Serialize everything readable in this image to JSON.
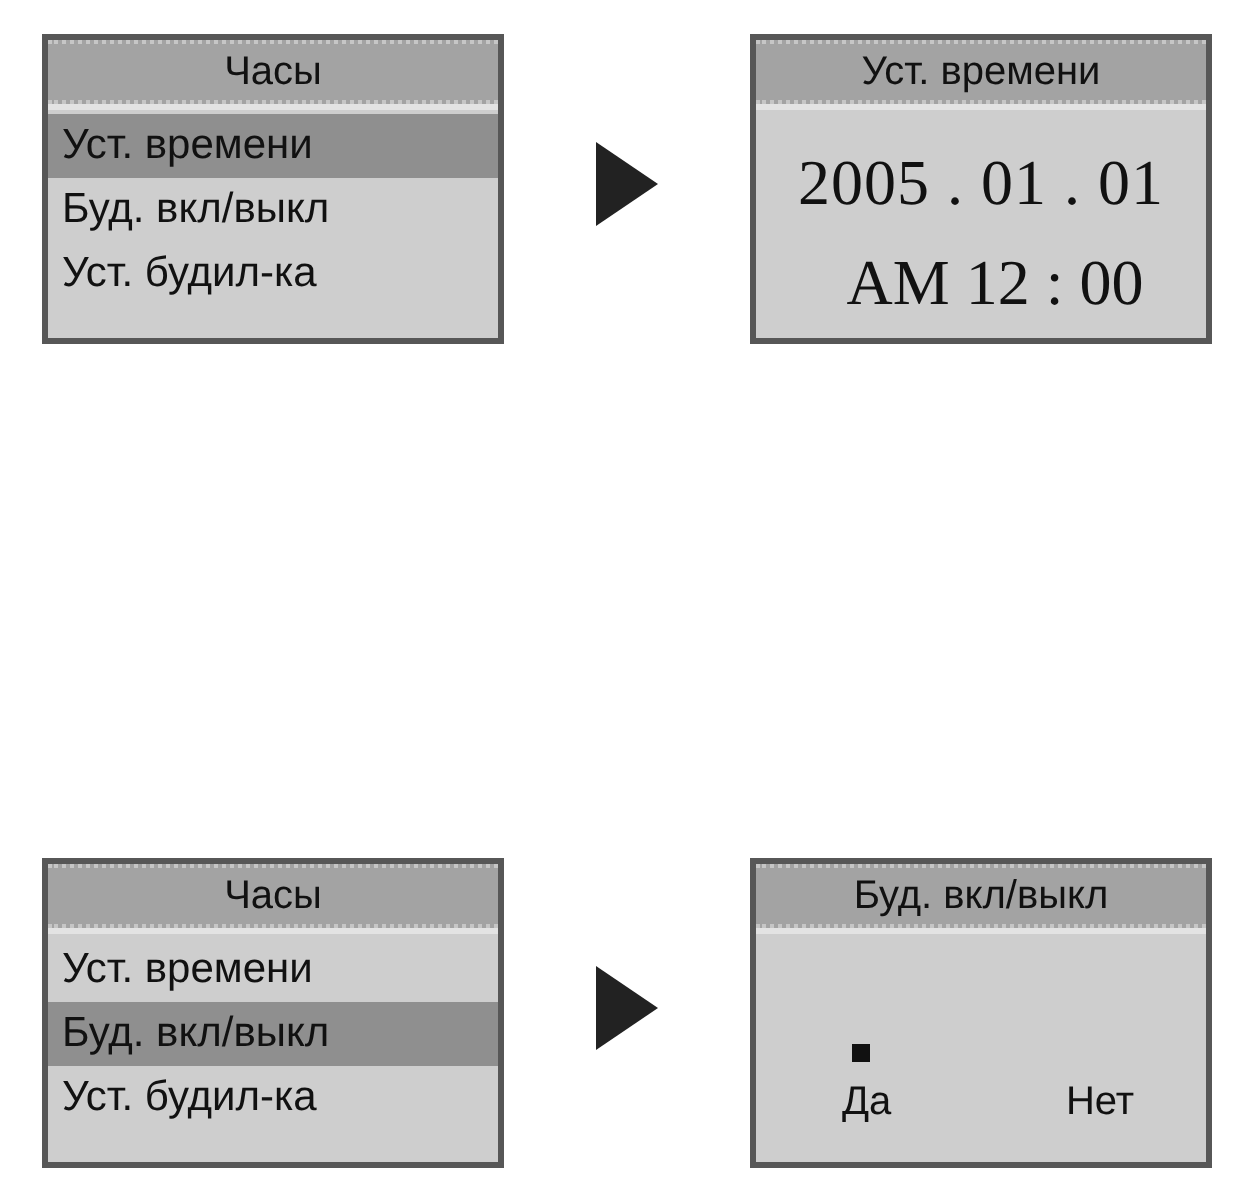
{
  "steps": [
    {
      "screens": [
        {
          "kind": "menu",
          "title": "Часы",
          "items": [
            {
              "label": "Уст. времени",
              "selected": true
            },
            {
              "label": "Буд. вкл/выкл",
              "selected": false
            },
            {
              "label": "Уст. будил-ка",
              "selected": false
            }
          ]
        },
        {
          "kind": "datetime",
          "title": "Уст. времени",
          "date": "2005 . 01 . 01",
          "time": "AM 12 : 00"
        }
      ]
    },
    {
      "screens": [
        {
          "kind": "menu",
          "title": "Часы",
          "items": [
            {
              "label": "Уст. времени",
              "selected": false
            },
            {
              "label": "Буд. вкл/выкл",
              "selected": true
            },
            {
              "label": "Уст. будил-ка",
              "selected": false
            }
          ]
        },
        {
          "kind": "choice",
          "title": "Буд. вкл/выкл",
          "options": [
            {
              "label": "Да",
              "selected": true
            },
            {
              "label": "Нет",
              "selected": false
            }
          ]
        }
      ]
    }
  ]
}
